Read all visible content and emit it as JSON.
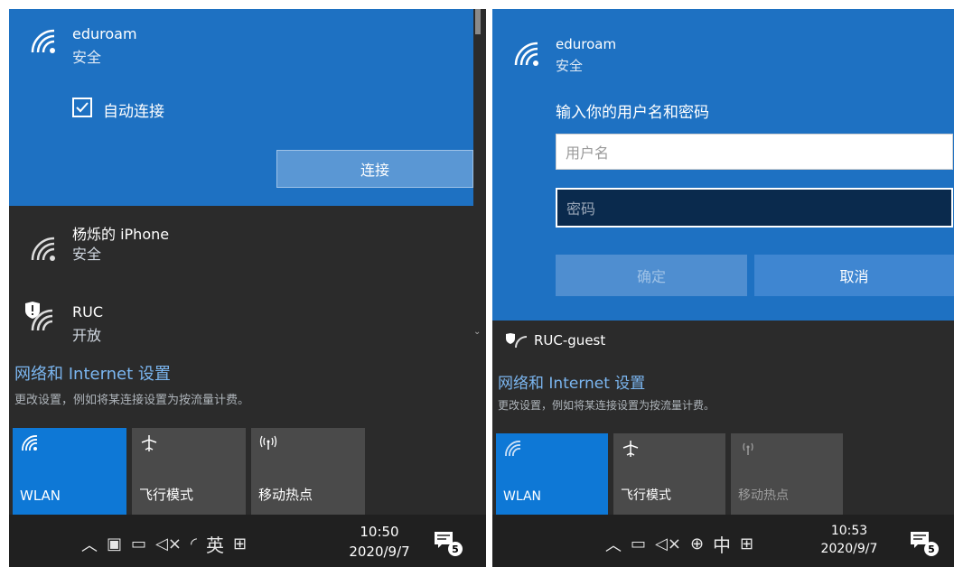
{
  "left": {
    "network_top": {
      "name": "eduroam",
      "status": "安全"
    },
    "auto_connect_label": "自动连接",
    "connect_label": "连接",
    "networks": [
      {
        "name": "杨烁的 iPhone",
        "status": "安全"
      },
      {
        "name": "RUC",
        "status": "开放"
      }
    ],
    "settings_title": "网络和 Internet 设置",
    "settings_sub": "更改设置，例如将某连接设置为按流量计费。",
    "tiles": [
      {
        "label": "WLAN",
        "icon": "wifi-icon",
        "active": true
      },
      {
        "label": "飞行模式",
        "icon": "airplane-icon",
        "active": false
      },
      {
        "label": "移动热点",
        "icon": "hotspot-icon",
        "active": false
      }
    ],
    "taskbar": {
      "ime": "英",
      "time": "10:50",
      "date": "2020/9/7",
      "notifications": "5"
    }
  },
  "right": {
    "network_top": {
      "name": "eduroam",
      "status": "安全"
    },
    "prompt": "输入你的用户名和密码",
    "username_placeholder": "用户名",
    "password_placeholder": "密码",
    "ok_label": "确定",
    "cancel_label": "取消",
    "next_network": "RUC-guest",
    "settings_title": "网络和 Internet 设置",
    "settings_sub": "更改设置，例如将某连接设置为按流量计费。",
    "tiles": [
      {
        "label": "WLAN",
        "icon": "wifi-icon",
        "active": true
      },
      {
        "label": "飞行模式",
        "icon": "airplane-icon",
        "active": false
      },
      {
        "label": "移动热点",
        "icon": "hotspot-icon",
        "active": false
      }
    ],
    "taskbar": {
      "ime": "中",
      "time": "10:53",
      "date": "2020/9/7",
      "notifications": "5"
    }
  },
  "colors": {
    "accent": "#1e71c2",
    "flyout_bg": "#2b2b2b",
    "taskbar_bg": "#202020",
    "tile_active": "#0e78d6",
    "tile_inactive": "#4a4a4a",
    "link": "#7bb6f0"
  }
}
